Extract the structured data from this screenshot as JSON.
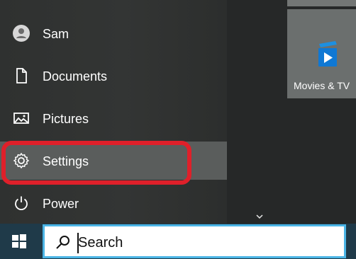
{
  "start_menu": {
    "items": [
      {
        "label": "Sam",
        "icon": "avatar-icon"
      },
      {
        "label": "Documents",
        "icon": "document-icon"
      },
      {
        "label": "Pictures",
        "icon": "pictures-icon"
      },
      {
        "label": "Settings",
        "icon": "gear-icon"
      },
      {
        "label": "Power",
        "icon": "power-icon"
      }
    ]
  },
  "tiles": {
    "movies_label": "Movies & TV"
  },
  "taskbar": {
    "search_value": "Search",
    "search_icon": "search-icon",
    "start_icon": "windows-icon"
  },
  "colors": {
    "accent": "#4bb5e6",
    "highlight": "#df202a",
    "taskbar": "#1f3a49"
  }
}
